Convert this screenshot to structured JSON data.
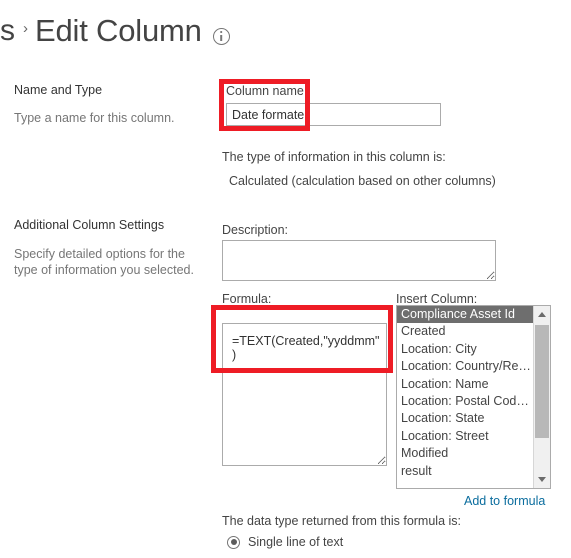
{
  "header": {
    "breadcrumb_tail": "s",
    "breadcrumb_separator": "›",
    "title": "Edit Column",
    "info_icon": "info-icon"
  },
  "sections": {
    "name_and_type": {
      "title": "Name and Type",
      "description": "Type a name for this column."
    },
    "additional_settings": {
      "title": "Additional Column Settings",
      "description": "Specify detailed options for the type of information you selected."
    }
  },
  "form": {
    "column_name_label": "Column name:",
    "column_name_value": "Date formate",
    "column_name_placeholder": "",
    "type_prompt": "The type of information in this column is:",
    "type_value": "Calculated (calculation based on other columns)",
    "description_label": "Description:",
    "description_value": "",
    "description_placeholder": "",
    "formula_label": "Formula:",
    "formula_value": "=TEXT(Created,\"yyddmm\")",
    "formula_placeholder": "",
    "insert_column_label": "Insert Column:",
    "insert_column_options": [
      "Compliance Asset Id",
      "Created",
      "Location: City",
      "Location: Country/Re…",
      "Location: Name",
      "Location: Postal Cod…",
      "Location: State",
      "Location: Street",
      "Modified",
      "result"
    ],
    "insert_column_selected": "Compliance Asset Id",
    "add_to_formula_link": "Add to formula",
    "data_type_prompt": "The data type returned from this formula is:",
    "data_type_options": [
      {
        "label": "Single line of text",
        "checked": true
      }
    ]
  },
  "colors": {
    "annotation_red": "#ee1c25",
    "link_blue": "#0b6d9e",
    "selection_gray": "#6e6e6e",
    "text_dark": "#444444",
    "text_muted": "#767676",
    "border_gray": "#ababab"
  }
}
